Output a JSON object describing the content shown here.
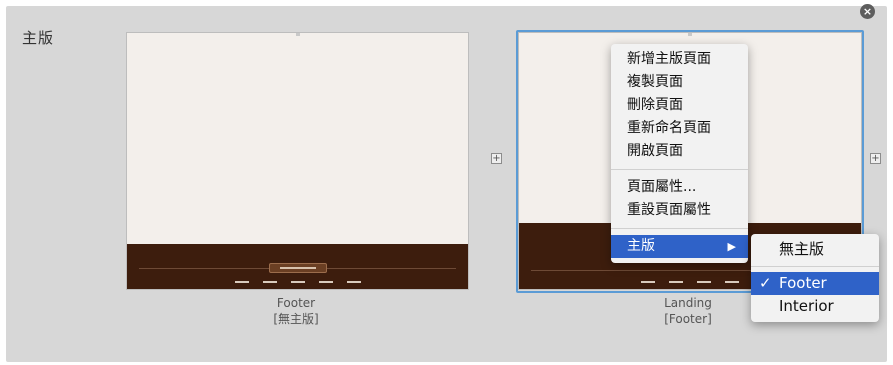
{
  "section_label": "主版",
  "close_icon": "close-icon",
  "thumbnails": [
    {
      "caption_name": "Footer",
      "caption_master": "[無主版]"
    },
    {
      "caption_name": "Landing",
      "caption_master": "[Footer]"
    }
  ],
  "add_icon": "plus-icon",
  "context_menu": {
    "items": [
      "新增主版頁面",
      "複製頁面",
      "刪除頁面",
      "重新命名頁面",
      "開啟頁面"
    ],
    "items2": [
      "頁面屬性...",
      "重設頁面屬性"
    ],
    "master": {
      "label": "主版",
      "arrow": "▶"
    }
  },
  "submenu": {
    "none": "無主版",
    "options": [
      "Footer",
      "Interior"
    ],
    "checked": "Footer",
    "check_glyph": "✓"
  },
  "colors": {
    "highlight": "#2f62c8",
    "selection": "#5b9bd5",
    "footer_brown": "#3d1d0d"
  }
}
